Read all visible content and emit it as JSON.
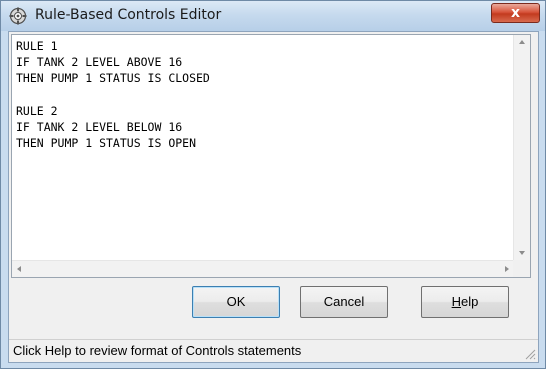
{
  "window": {
    "title": "Rule-Based Controls Editor",
    "close_label": "x"
  },
  "editor": {
    "text": "RULE 1\nIF TANK 2 LEVEL ABOVE 16\nTHEN PUMP 1 STATUS IS CLOSED\n\nRULE 2\nIF TANK 2 LEVEL BELOW 16\nTHEN PUMP 1 STATUS IS OPEN"
  },
  "buttons": {
    "ok": "OK",
    "cancel": "Cancel",
    "help_mnemonic": "H",
    "help_rest": "elp"
  },
  "statusbar": {
    "text": "Click Help to review format of Controls statements"
  },
  "icons": {
    "app": "rule-editor-app-icon",
    "close": "close-icon",
    "grip": "resize-grip-icon"
  },
  "colors": {
    "titlebar": "#c6daee",
    "close_button": "#d8553c",
    "dialog_face": "#f0f0f0",
    "default_button_border": "#3c7fb1"
  }
}
